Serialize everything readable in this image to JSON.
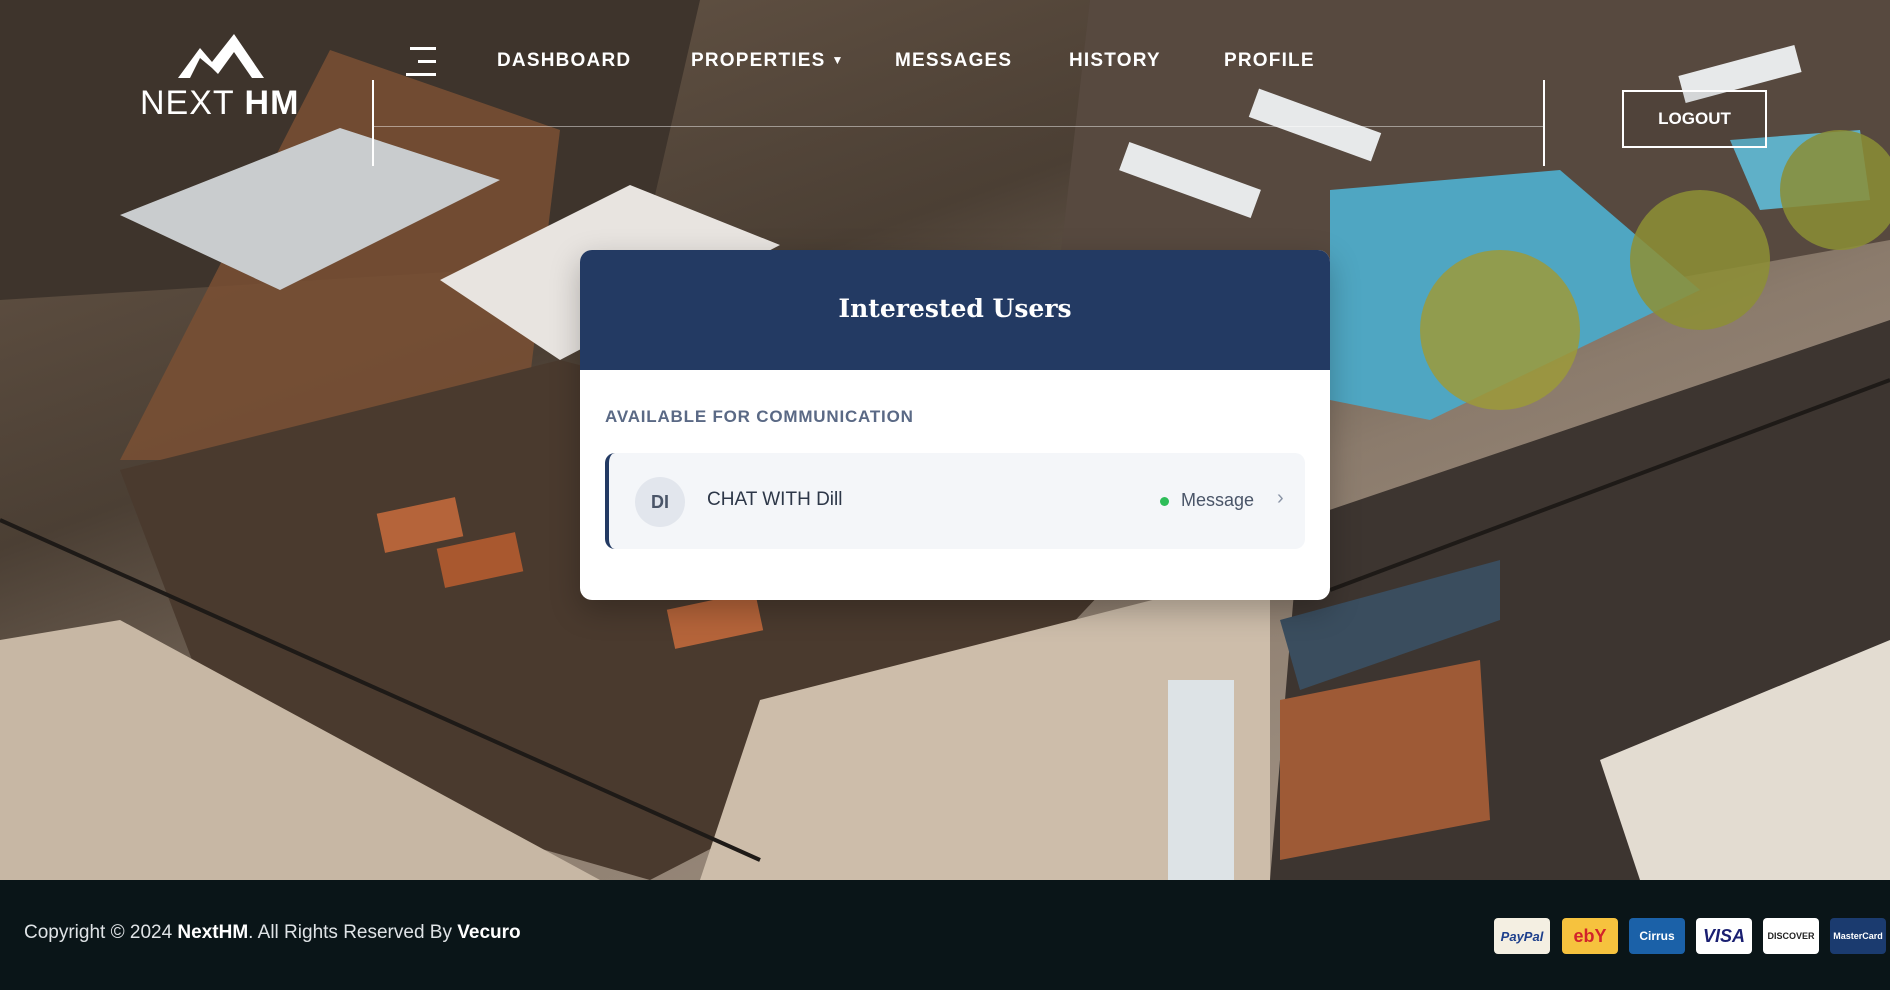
{
  "brand": {
    "logo_left": "NEXT",
    "logo_right": "HM"
  },
  "nav": {
    "items": [
      {
        "label": "DASHBOARD"
      },
      {
        "label": "PROPERTIES"
      },
      {
        "label": "MESSAGES"
      },
      {
        "label": "HISTORY"
      },
      {
        "label": "PROFILE"
      }
    ],
    "logout_label": "LOGOUT"
  },
  "card": {
    "title": "Interested Users",
    "section_label": "AVAILABLE FOR COMMUNICATION",
    "users": [
      {
        "initials": "DI",
        "chat_label": "CHAT WITH Dill",
        "action_label": "Message",
        "status": "online"
      }
    ]
  },
  "footer": {
    "copyright_prefix": "Copyright © 2024 ",
    "brand": "NextHM",
    "copyright_mid": ". All Rights Reserved By ",
    "author": "Vecuro",
    "payment_methods": [
      {
        "name": "PayPal"
      },
      {
        "name": "ebY"
      },
      {
        "name": "Cirrus"
      },
      {
        "name": "VISA"
      },
      {
        "name": "DISCOVER"
      },
      {
        "name": "MasterCard"
      }
    ]
  },
  "colors": {
    "primary": "#233a63",
    "footer_bg": "#0a1518",
    "online": "#2ebd59",
    "section_label": "#5a6985"
  },
  "icons": {
    "logo": "roof-logo-icon",
    "menu": "hamburger-menu-icon",
    "dropdown": "chevron-down-icon",
    "status": "online-dot-icon",
    "row_arrow": "chevron-right-icon"
  }
}
